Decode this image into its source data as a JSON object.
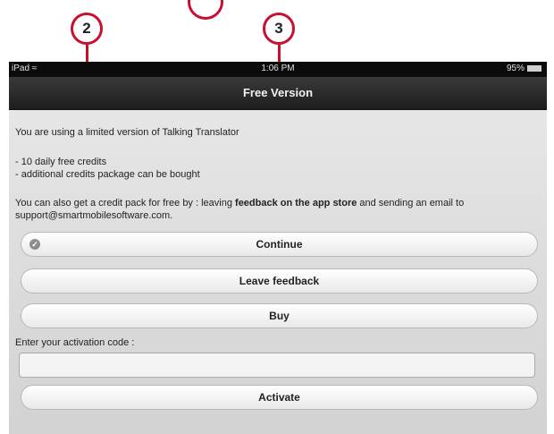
{
  "callouts": {
    "first": "2",
    "second": "3",
    "color": "#c8102e"
  },
  "status_bar": {
    "device": "iPad",
    "wifi_icon": "wifi-icon",
    "time": "1:06 PM",
    "battery": "95%"
  },
  "nav": {
    "title": "Free Version"
  },
  "content": {
    "intro": "You are using a limited version of Talking Translator",
    "bullet_1": "- 10 daily free credits",
    "bullet_2": "- additional credits package can be bought",
    "credit_text_1": "You can also get a credit pack for free by : leaving ",
    "credit_text_bold": "feedback on the app store",
    "credit_text_2": " and sending an email to",
    "credit_text_3": "support@smartmobilesoftware.com.",
    "activation_label": "Enter your activation code :"
  },
  "buttons": {
    "continue": "Continue",
    "leave_feedback": "Leave feedback",
    "buy": "Buy",
    "activate": "Activate"
  },
  "activation_input": {
    "value": ""
  }
}
